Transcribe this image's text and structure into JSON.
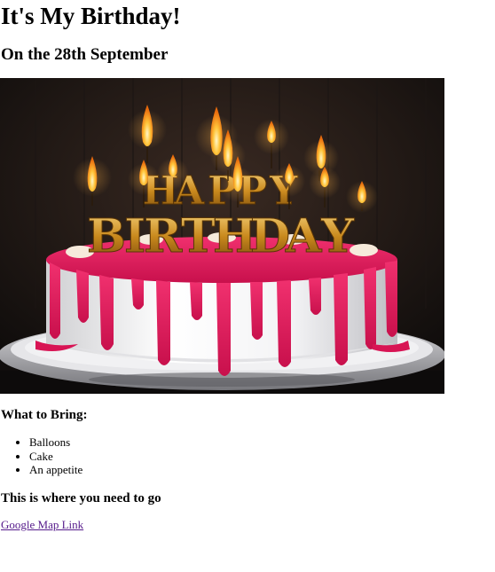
{
  "page": {
    "title": "It's My Birthday!",
    "subtitle": "On the 28th September"
  },
  "image": {
    "subject": "birthday-cake",
    "candle_lettering": "HAPPY BIRTHDAY"
  },
  "bring": {
    "heading": "What to Bring:",
    "items": [
      "Balloons",
      "Cake",
      "An appetite"
    ]
  },
  "location": {
    "heading": "This is where you need to go",
    "link_label": "Google Map Link"
  },
  "colors": {
    "link": "#551a8b",
    "text": "#000000",
    "background": "#ffffff",
    "icing": "#e0195a",
    "frosting": "#f4f2f2"
  }
}
